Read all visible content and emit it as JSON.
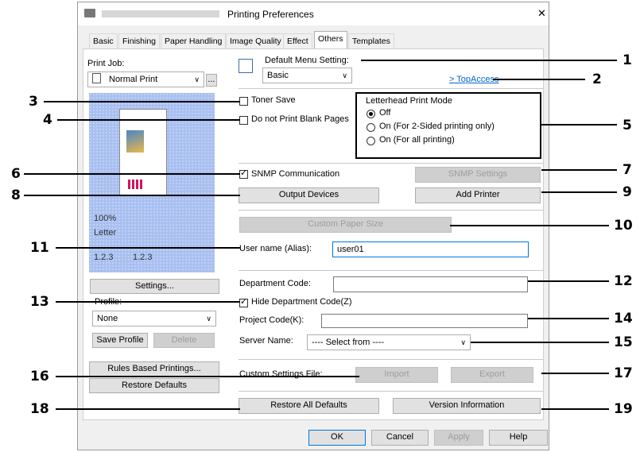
{
  "window": {
    "title": "Printing Preferences",
    "close_glyph": "✕"
  },
  "tabs": [
    "Basic",
    "Finishing",
    "Paper Handling",
    "Image Quality",
    "Effect",
    "Others",
    "Templates"
  ],
  "left": {
    "print_job_label": "Print Job:",
    "print_job_value": "Normal Print",
    "zoom": "100%",
    "paper": "Letter",
    "sort_a": "1.2.3",
    "sort_b": "1.2.3",
    "settings_button": "Settings...",
    "profile_label": "Profile:",
    "profile_value": "None",
    "save_profile": "Save Profile",
    "delete": "Delete",
    "rules_based": "Rules Based Printings...",
    "restore_defaults": "Restore Defaults"
  },
  "main": {
    "default_menu_label": "Default Menu Setting:",
    "default_menu_value": "Basic",
    "topaccess_link": "> TopAccess",
    "toner_save": "Toner Save",
    "no_blank_pages": "Do not Print Blank Pages",
    "letterhead_title": "Letterhead Print Mode",
    "letterhead_options": [
      "Off",
      "On (For 2-Sided printing only)",
      "On (For all printing)"
    ],
    "snmp_label": "SNMP Communication",
    "snmp_settings": "SNMP Settings",
    "output_devices": "Output Devices",
    "add_printer": "Add Printer",
    "custom_paper": "Custom Paper Size",
    "user_name_label": "User name (Alias):",
    "user_name_value": "user01",
    "dept_code_label": "Department Code:",
    "dept_code_value": "",
    "hide_dept": "Hide Department Code(Z)",
    "project_code_label": "Project Code(K):",
    "project_code_value": "",
    "server_name_label": "Server Name:",
    "server_name_value": "---- Select from ----",
    "custom_settings_label": "Custom Settings File:",
    "import": "Import",
    "export": "Export",
    "restore_all": "Restore All Defaults",
    "version_info": "Version Information"
  },
  "footer": {
    "ok": "OK",
    "cancel": "Cancel",
    "apply": "Apply",
    "help": "Help"
  },
  "callouts": [
    "1",
    "2",
    "3",
    "4",
    "5",
    "6",
    "7",
    "8",
    "9",
    "10",
    "11",
    "12",
    "13",
    "14",
    "15",
    "16",
    "17",
    "18",
    "19"
  ]
}
